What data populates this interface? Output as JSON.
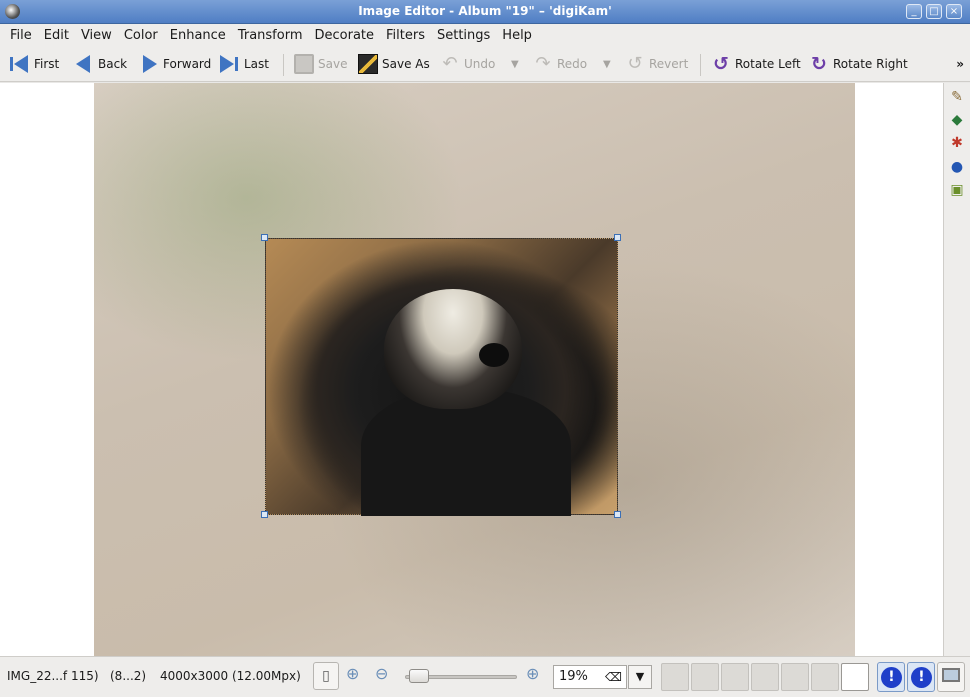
{
  "window": {
    "title": "Image Editor - Album \"19\" – 'digiKam'",
    "buttons": [
      "_",
      "□",
      "×"
    ]
  },
  "menu": [
    "File",
    "Edit",
    "View",
    "Color",
    "Enhance",
    "Transform",
    "Decorate",
    "Filters",
    "Settings",
    "Help"
  ],
  "toolbar": {
    "first": "First",
    "back": "Back",
    "forward": "Forward",
    "last": "Last",
    "save": "Save",
    "save_as": "Save As",
    "undo": "Undo",
    "redo": "Redo",
    "revert": "Revert",
    "rotate_left": "Rotate Left",
    "rotate_right": "Rotate Right",
    "more": "»"
  },
  "sidebar": {
    "icons": [
      "brush-icon",
      "palette-icon",
      "color-picker-icon",
      "globe-icon",
      "layers-icon"
    ]
  },
  "statusbar": {
    "filename": "IMG_22...f 115)",
    "position": "(8...2)",
    "dimensions": "4000x3000 (12.00Mpx)",
    "zoom_value": "19%",
    "zoom_level_percent": 19
  },
  "image": {
    "selection_active": true
  }
}
